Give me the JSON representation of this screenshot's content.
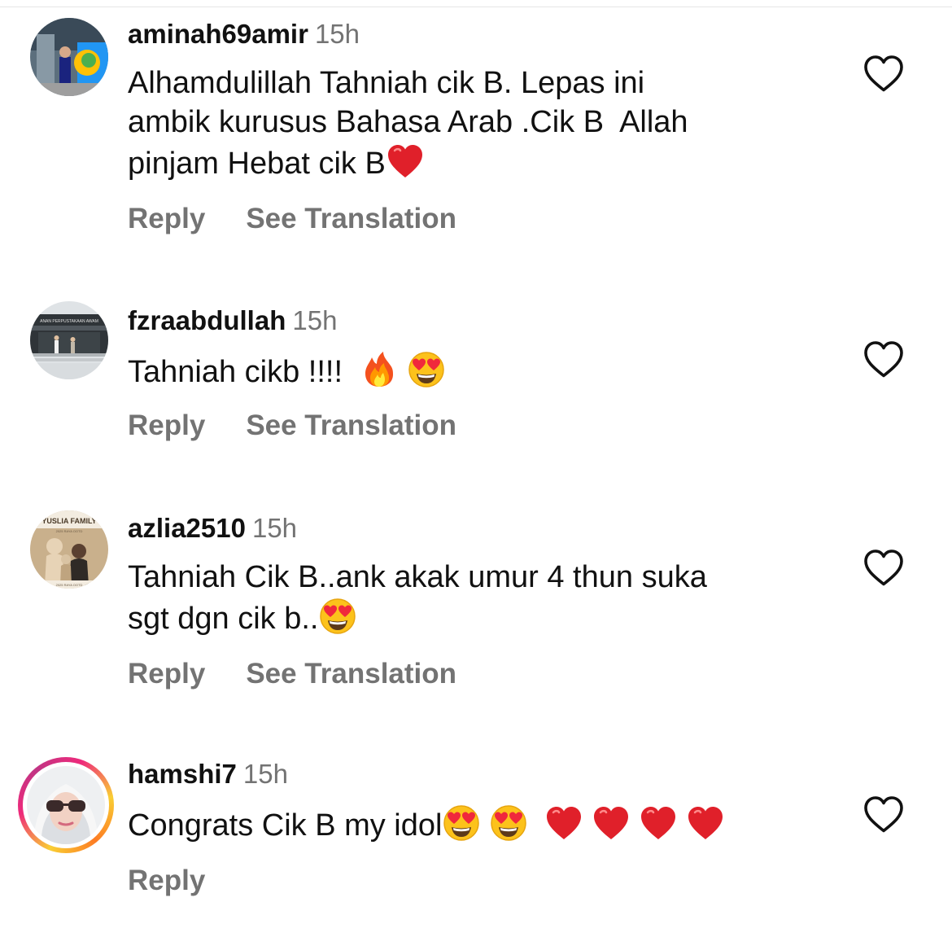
{
  "comments": [
    {
      "username": "aminah69amir",
      "time": "15h",
      "lines": [
        "Alhamdulillah Tahniah cik B. Lepas ini",
        "ambik kurusus Bahasa Arab .Cik B  Allah",
        "pinjam Hebat cik B"
      ],
      "emoji_after_last_line": [
        "red-heart"
      ],
      "reply_label": "Reply",
      "translate_label": "See Translation"
    },
    {
      "username": "fzraabdullah",
      "time": "15h",
      "lines": [
        "Tahniah cikb !!!! "
      ],
      "emoji_after_last_line": [
        "fire",
        "heart-eyes"
      ],
      "avatar_text": "ANAN PERPUSTAKAAN AWAM",
      "reply_label": "Reply",
      "translate_label": "See Translation"
    },
    {
      "username": "azlia2510",
      "time": "15h",
      "lines": [
        "Tahniah Cik B..ank akak umur 4 thun suka",
        "sgt dgn cik b.."
      ],
      "emoji_after_last_line": [
        "heart-eyes"
      ],
      "avatar_text_top": "YUSLIA FAMILY",
      "avatar_text_sub": "2025 RAYA OOTD",
      "avatar_text_bottom": "2025 RAYA OOTD",
      "reply_label": "Reply",
      "translate_label": "See Translation"
    },
    {
      "username": "hamshi7",
      "time": "15h",
      "lines": [
        "Congrats Cik B my idol"
      ],
      "emoji_after_last_line": [
        "heart-eyes",
        "heart-eyes",
        "red-heart",
        "red-heart",
        "red-heart",
        "red-heart"
      ],
      "reply_label": "Reply"
    }
  ],
  "colors": {
    "text": "#111111",
    "secondary": "#737373",
    "heart_emoji": "#e0202a",
    "story_ring": [
      "#f9ce34",
      "#ee2a7b",
      "#c13584"
    ]
  },
  "icons": {
    "like": "heart-outline-icon",
    "emoji_red_heart": "red-heart-emoji",
    "emoji_fire": "fire-emoji",
    "emoji_heart_eyes": "heart-eyes-emoji"
  }
}
